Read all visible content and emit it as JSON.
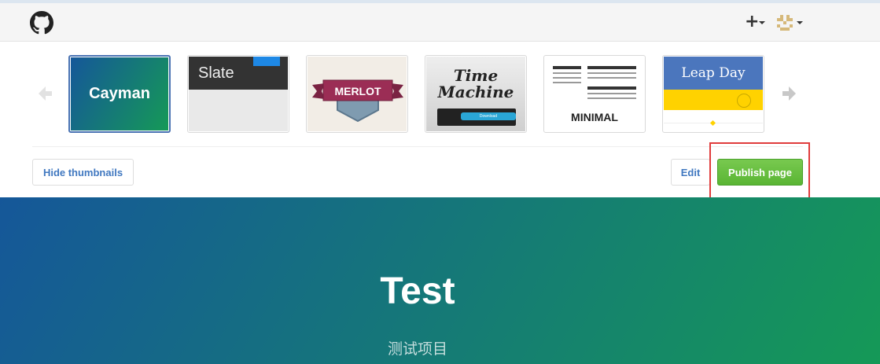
{
  "header": {
    "new_menu_label": "+",
    "logo_icon": "github-octocat-icon",
    "avatar_icon": "identicon-avatar"
  },
  "themes": {
    "items": [
      {
        "name": "Cayman",
        "label": "Cayman",
        "selected": true
      },
      {
        "name": "Slate",
        "label": "Slate",
        "selected": false
      },
      {
        "name": "Merlot",
        "label": "MERLOT",
        "selected": false
      },
      {
        "name": "Time Machine",
        "label_line1": "Time",
        "label_line2": "Machine",
        "button_label": "Download",
        "selected": false
      },
      {
        "name": "Minimal",
        "label": "MINIMAL",
        "selected": false
      },
      {
        "name": "Leap Day",
        "label": "Leap Day",
        "selected": false
      }
    ],
    "prev_icon": "arrow-left-icon",
    "next_icon": "arrow-right-icon"
  },
  "actions": {
    "hide_thumbnails": "Hide thumbnails",
    "edit": "Edit",
    "publish": "Publish page"
  },
  "preview": {
    "title": "Test",
    "subtitle": "测试项目"
  },
  "colors": {
    "accent_blue": "#4078c0",
    "publish_green": "#5ab534",
    "highlight_red": "#e03c3c",
    "cayman_start": "#155799",
    "cayman_end": "#159957"
  }
}
